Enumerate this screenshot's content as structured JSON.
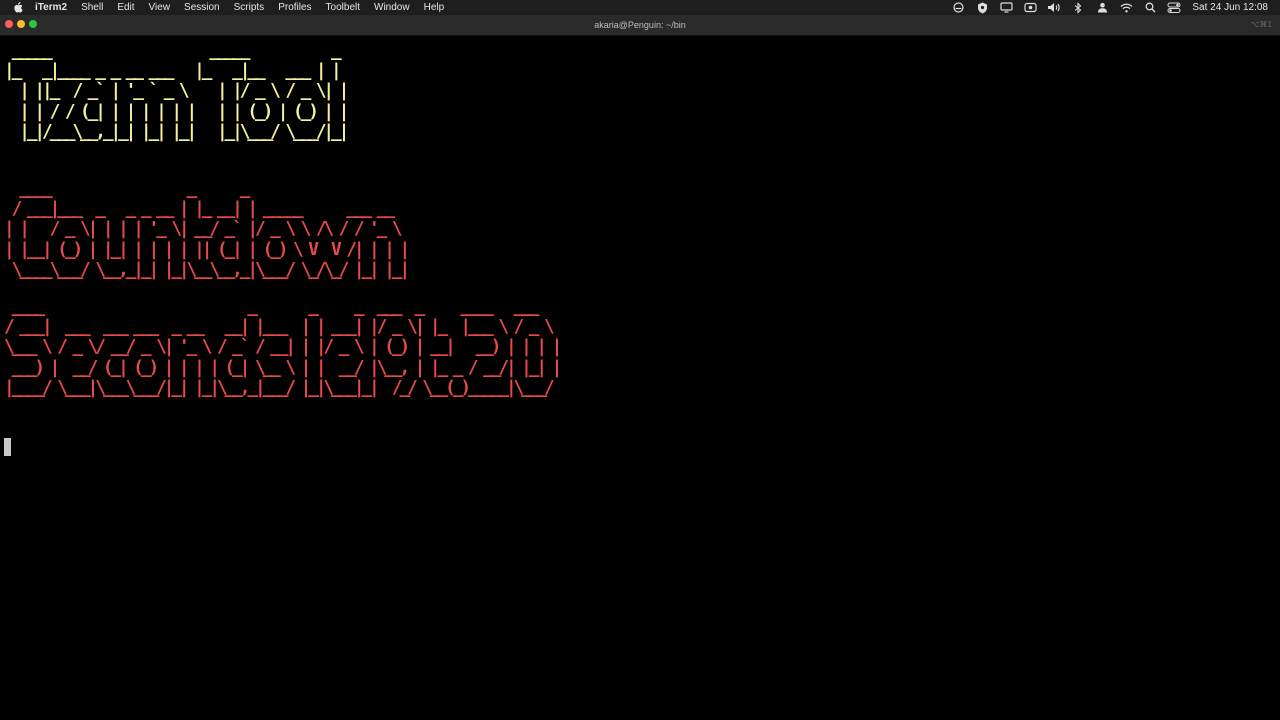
{
  "menubar": {
    "app_name": "iTerm2",
    "items": [
      "Shell",
      "Edit",
      "View",
      "Session",
      "Scripts",
      "Profiles",
      "Toolbelt",
      "Window",
      "Help"
    ],
    "clock": "Sat 24 Jun  12:08",
    "status_icons": [
      "cloud-icon",
      "shield-icon",
      "display-icon",
      "screen-record-icon",
      "volume-icon",
      "bluetooth-icon",
      "user-icon",
      "wifi-icon",
      "spotlight-search-icon",
      "control-center-icon"
    ]
  },
  "window": {
    "title": "akaria@Penguin: ~/bin",
    "shortcut": "⌥⌘1"
  },
  "terminal": {
    "art_lines_1": [
      " _____                     _____           _ ",
      "|_   _|____ _ _ __ ___   |_   _|__   ___ | |",
      "  | ||_  / _` | '_ ` _ \\    | |/ _ \\ / _ \\| |",
      "  | | / / (_| | | | | | |   | | (_) | (_) | |",
      "  |_|/___\\__,_|_| |_| |_|   |_|\\___/ \\___/|_|"
    ],
    "art_lines_2": [
      "  ____                  _      _                     ",
      " / ___|___  _   _ _ __ | |_ __| | _____      ___ __  ",
      "| |   / _ \\| | | | '_ \\| __/ _` |/ _ \\ \\ /\\ / / '_ \\ ",
      "| |__| (_) | |_| | | | | || (_| | (_) \\ V  V /| | | |",
      " \\____\\___/ \\__,_|_| |_|\\__\\__,_|\\___/ \\_/\\_/ |_| |_|"
    ],
    "art_lines_3": [
      " ____                           _       _     _  ___  _     ____   ___  ",
      "/ ___|  ___  ___ ___  _ __   __| |___  | | ___| |/ _ \\| |_  |___ \\ / _ \\ ",
      "\\___ \\ / _ \\/ __/ _ \\| '_ \\ / _` / __| | |/ _ \\ | (_) | __|   __) | | | |",
      " ___) |  __/ (_| (_) | | | | (_| \\__ \\ | |  __/ |\\__, | |_ _ / __/| |_| |",
      "|____/ \\___|\\___\\___/|_| |_|\\__,_|___/ |_|\\___|_|  /_/ \\__(_)_____|\\___/ "
    ]
  }
}
